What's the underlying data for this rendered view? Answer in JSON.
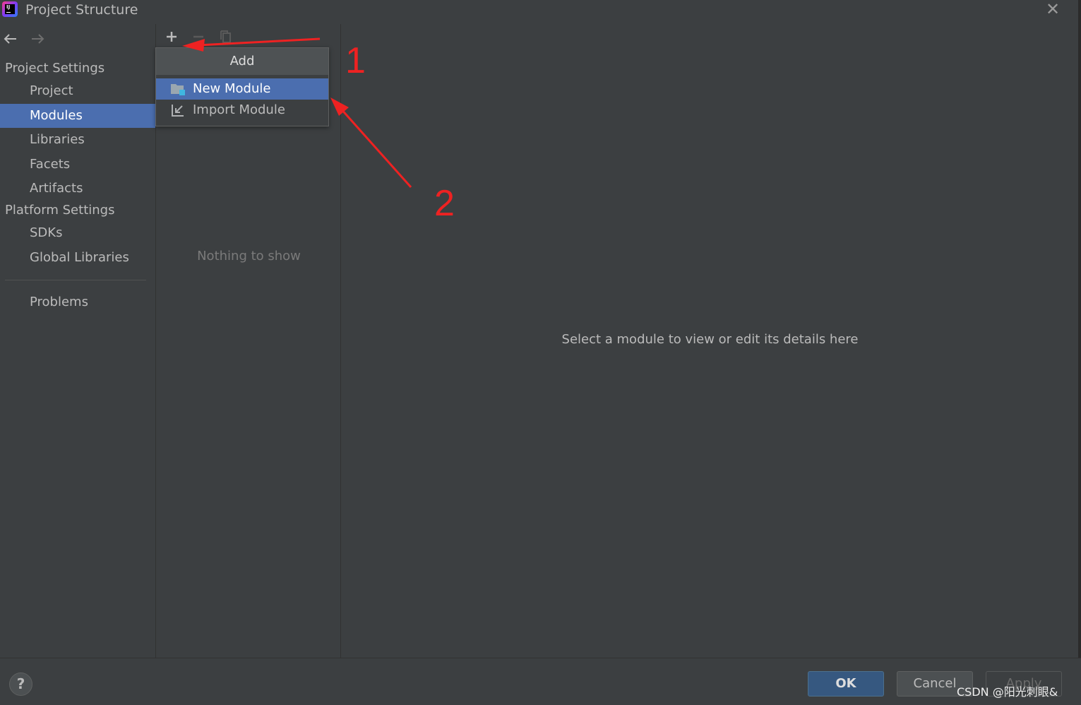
{
  "window": {
    "title": "Project Structure",
    "logo_text": "IJ"
  },
  "sidebar": {
    "project_settings_header": "Project Settings",
    "project_settings_items": [
      {
        "label": "Project"
      },
      {
        "label": "Modules",
        "selected": true
      },
      {
        "label": "Libraries"
      },
      {
        "label": "Facets"
      },
      {
        "label": "Artifacts"
      }
    ],
    "platform_settings_header": "Platform Settings",
    "platform_settings_items": [
      {
        "label": "SDKs"
      },
      {
        "label": "Global Libraries"
      }
    ],
    "problems_label": "Problems"
  },
  "middle": {
    "empty_text": "Nothing to show"
  },
  "popup": {
    "header": "Add",
    "items": [
      {
        "label": "New Module",
        "icon": "folder-module-icon",
        "selected": true
      },
      {
        "label": "Import Module",
        "icon": "import-icon"
      }
    ]
  },
  "details": {
    "hint": "Select a module to view or edit its details here"
  },
  "buttons": {
    "help": "?",
    "ok": "OK",
    "cancel": "Cancel",
    "apply": "Apply"
  },
  "annotations": {
    "step1": "1",
    "step2": "2",
    "color": "#ee2222"
  },
  "watermark": "CSDN @阳光刺眼&",
  "colors": {
    "background": "#3c3f41",
    "selection": "#4b6eaf",
    "ok_button": "#365880"
  }
}
